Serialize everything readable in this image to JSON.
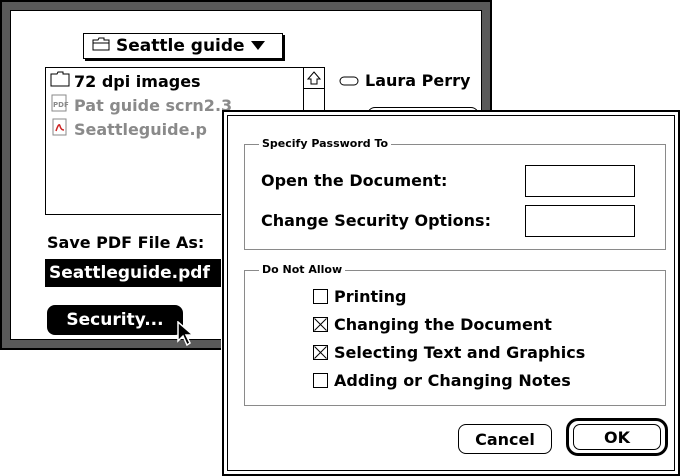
{
  "back_dialog": {
    "folder_popup": {
      "label": "Seattle guide",
      "icon": "folder-icon"
    },
    "files": [
      {
        "name": "72 dpi images",
        "icon": "folder-icon",
        "enabled": true
      },
      {
        "name": "Pat guide scrn2.3",
        "icon": "pdf-file-icon",
        "enabled": false
      },
      {
        "name": "Seattleguide.p",
        "icon": "acrobat-file-icon",
        "enabled": false
      }
    ],
    "user": {
      "name": "Laura Perry",
      "icon": "drive-icon"
    },
    "save_label": "Save PDF File As:",
    "save_value": "Seattleguide.pdf",
    "security_button": "Security..."
  },
  "front_dialog": {
    "password_group": {
      "legend": "Specify Password To",
      "open_label": "Open the Document:",
      "change_label": "Change Security Options:",
      "open_value": "",
      "change_value": ""
    },
    "not_allow_group": {
      "legend": "Do Not Allow",
      "options": [
        {
          "label": "Printing",
          "checked": false
        },
        {
          "label": "Changing the Document",
          "checked": true
        },
        {
          "label": "Selecting Text and Graphics",
          "checked": true
        },
        {
          "label": "Adding or Changing Notes",
          "checked": false
        }
      ]
    },
    "cancel_button": "Cancel",
    "ok_button": "OK"
  }
}
